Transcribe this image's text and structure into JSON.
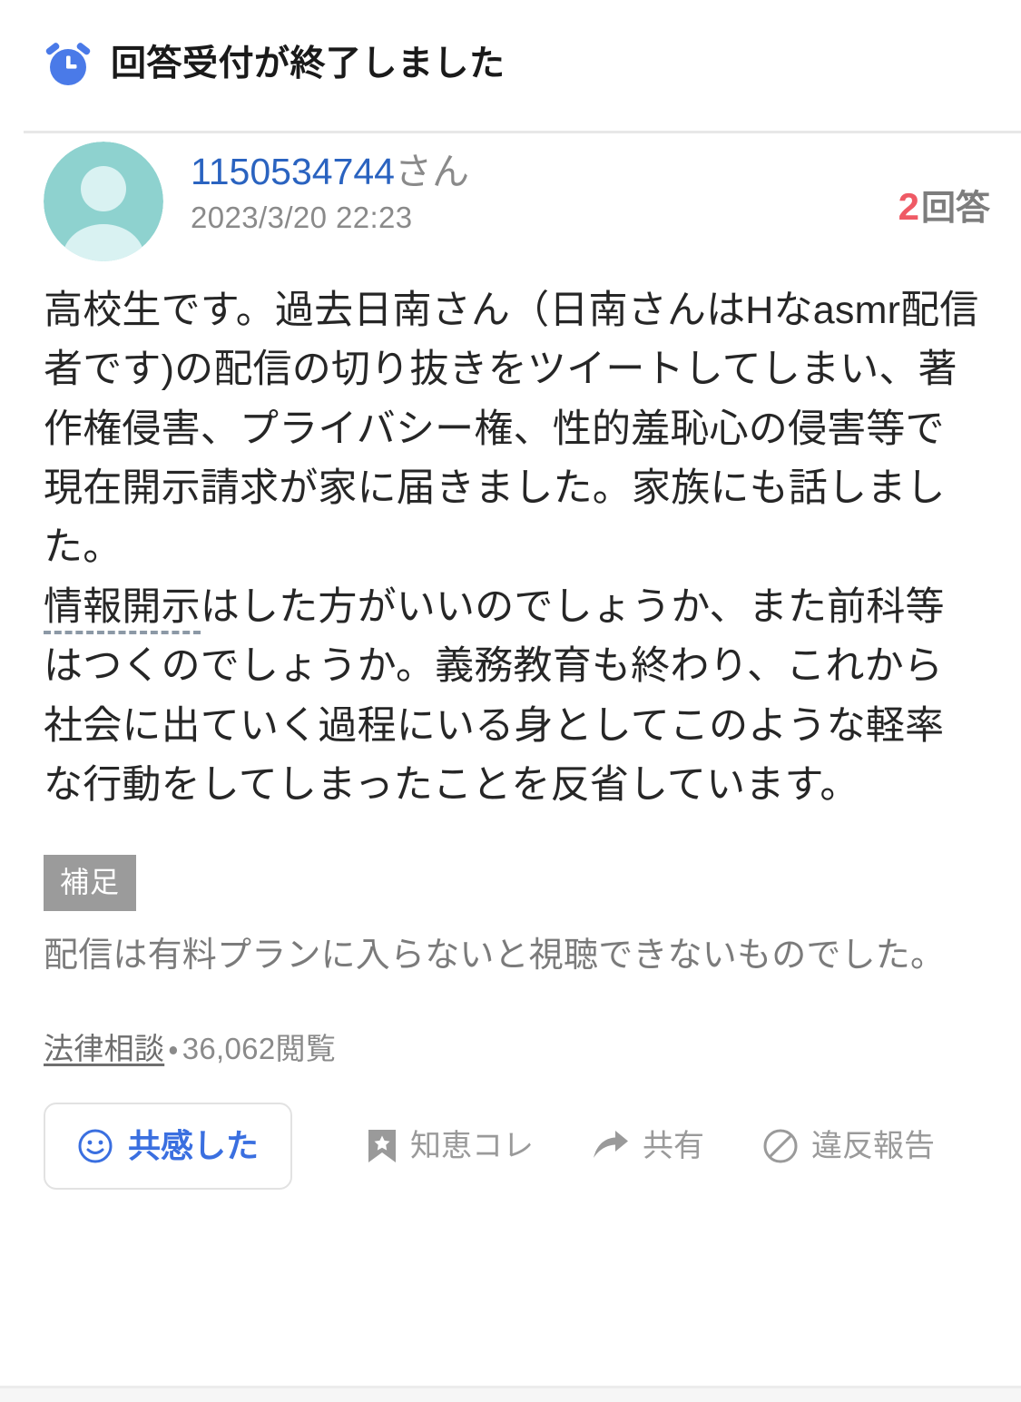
{
  "status_banner": {
    "icon": "alarm-clock-icon",
    "text": "回答受付が終了しました"
  },
  "author": {
    "avatar_icon": "default-user-avatar",
    "user_id": "1150534744",
    "name_suffix": "さん",
    "posted_at": "2023/3/20 22:23",
    "answer_count_number": "2",
    "answer_count_label": "回答"
  },
  "question": {
    "paragraph_1": "高校生です。過去日南さん（日南さんはHなasmr配信者です)の配信の切り抜きをツイートしてしまい、著作権侵害、プライバシー権、性的羞恥心の侵害等で現在開示請求が家に届きました。家族にも話しました。",
    "paragraph_2_keyword": "情報開示",
    "paragraph_2_rest": "はした方がいいのでしょうか、また前科等はつくのでしょうか。義務教育も終わり、これから社会に出ていく過程にいる身としてこのような軽率な行動をしてしまったことを反省しています。"
  },
  "supplement": {
    "badge": "補足",
    "text": "配信は有料プランに入らないと視聴できないものでした。"
  },
  "meta": {
    "category": "法律相談",
    "separator": "・",
    "views": "36,062閲覧"
  },
  "actions": {
    "empathy": {
      "label": "共感した",
      "icon": "smiley-face-icon"
    },
    "items": [
      {
        "label": "知恵コレ",
        "icon": "bookmark-star-icon"
      },
      {
        "label": "共有",
        "icon": "share-arrow-icon"
      },
      {
        "label": "違反報告",
        "icon": "prohibition-icon"
      }
    ]
  },
  "colors": {
    "accent_blue": "#4a7ae8",
    "link_blue": "#2a63c0",
    "answer_red": "#ef5a65",
    "avatar_teal": "#8ed2cf",
    "avatar_teal_light": "#d9f2f2",
    "badge_gray": "#9b9b9b",
    "muted_gray": "#8a8a8a",
    "divider": "#e8e8e8"
  }
}
